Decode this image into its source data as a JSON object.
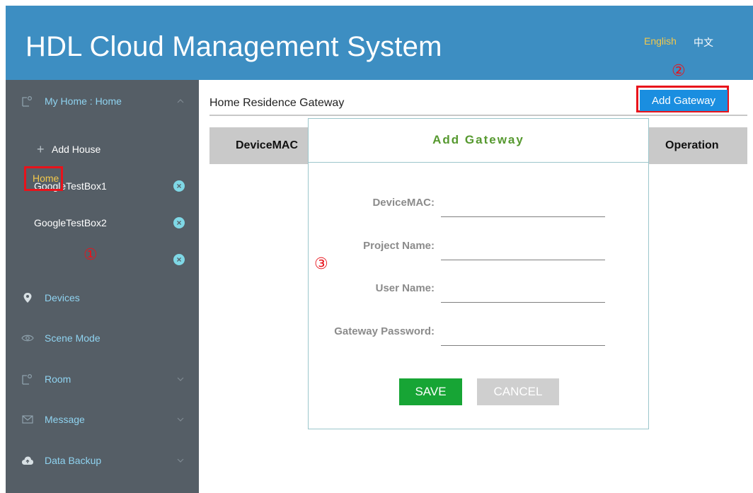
{
  "header": {
    "title": "HDL Cloud Management System",
    "lang_english": "English",
    "lang_chinese": "中文"
  },
  "sidebar": {
    "my_home": "My Home : Home",
    "add_house": "Add House",
    "houses": [
      "GoogleTestBox1",
      "GoogleTestBox2",
      "Home"
    ],
    "delete_glyph": "×",
    "items": {
      "devices": "Devices",
      "scene_mode": "Scene Mode",
      "room": "Room",
      "message": "Message",
      "data_backup": "Data Backup"
    }
  },
  "main": {
    "title": "Home Residence Gateway",
    "add_gateway_button": "Add Gateway",
    "columns": [
      "DeviceMAC",
      "Operation"
    ]
  },
  "modal": {
    "title": "Add Gateway",
    "fields": {
      "device_mac": "DeviceMAC:",
      "project_name": "Project Name:",
      "user_name": "User Name:",
      "gateway_password": "Gateway Password:"
    },
    "save": "SAVE",
    "cancel": "CANCEL"
  },
  "annotations": [
    "①",
    "②",
    "③"
  ],
  "colors": {
    "header_bg": "#3d8ec2",
    "sidebar_bg": "#555e66",
    "accent_blue": "#1a8ee0",
    "save_green": "#17a535",
    "highlight_red": "#e8131b",
    "active_yellow": "#f2c84b"
  }
}
